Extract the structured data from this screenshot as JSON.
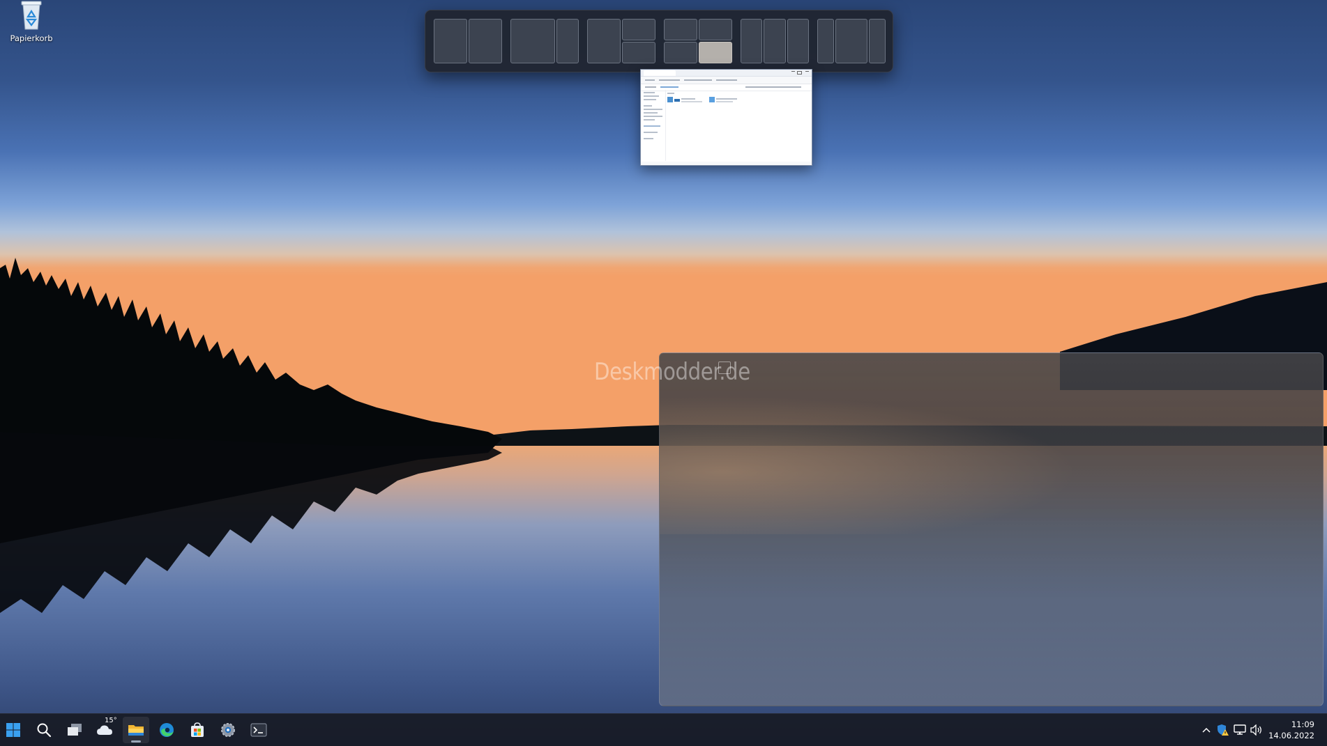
{
  "desktop": {
    "icons": [
      {
        "label": "Papierkorb",
        "icon": "recycle-bin-icon"
      }
    ],
    "watermark": "Deskmodder.de"
  },
  "snap_flyout": {
    "layouts": [
      {
        "name": "two-equal-columns",
        "zones": 2
      },
      {
        "name": "two-columns-wide-left",
        "zones": 2
      },
      {
        "name": "left-column-right-stacked",
        "zones": 3
      },
      {
        "name": "four-quadrants",
        "zones": 4,
        "highlighted_zone": 4
      },
      {
        "name": "three-equal-columns",
        "zones": 3
      },
      {
        "name": "three-columns-wide-center",
        "zones": 3
      }
    ]
  },
  "thumbnail_window": {
    "app": "file-explorer",
    "icon": "folder-icon"
  },
  "taskbar": {
    "items": [
      {
        "name": "start",
        "icon": "windows-logo-icon"
      },
      {
        "name": "search",
        "icon": "search-icon"
      },
      {
        "name": "task-view",
        "icon": "task-view-icon"
      },
      {
        "name": "widgets",
        "icon": "weather-cloud-icon",
        "temperature": "15°"
      },
      {
        "name": "file-explorer",
        "icon": "folder-icon",
        "active": true
      },
      {
        "name": "edge",
        "icon": "edge-browser-icon"
      },
      {
        "name": "store",
        "icon": "store-bag-icon"
      },
      {
        "name": "settings",
        "icon": "gear-icon"
      },
      {
        "name": "terminal",
        "icon": "terminal-icon"
      }
    ],
    "tray": {
      "icons": [
        "chevron-up-icon",
        "security-warning-icon",
        "network-icon",
        "speaker-icon"
      ],
      "time": "11:09",
      "date": "14.06.2022"
    }
  },
  "colors": {
    "accent": "#0078d4",
    "snap_zone": "#3c4350",
    "snap_zone_active": "#b4b0ab",
    "taskbar": "#181c28"
  }
}
